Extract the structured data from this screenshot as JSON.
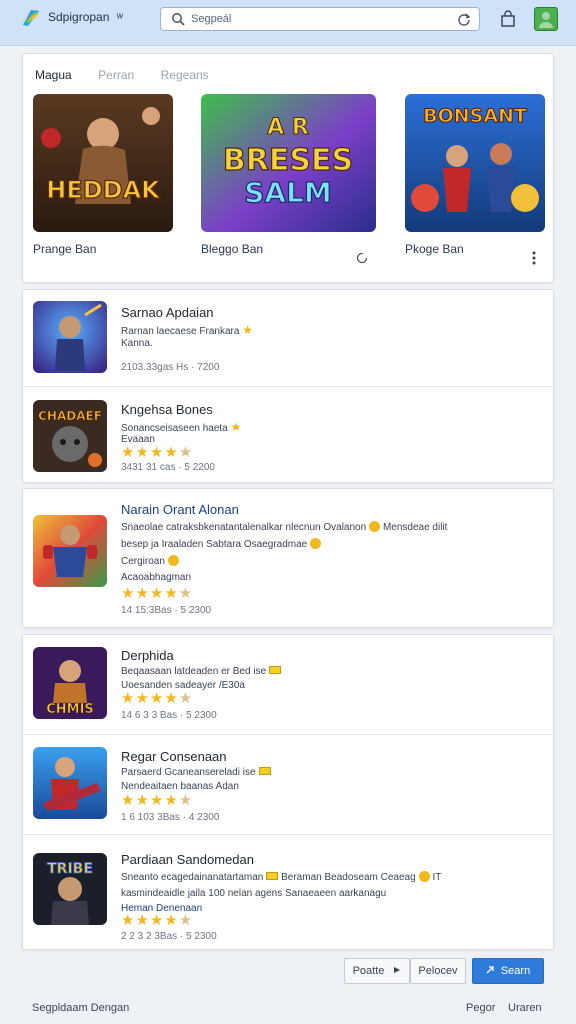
{
  "header": {
    "brand": "Sdpigropan",
    "brand_mark": "ᵂ",
    "search_value": "Segpeál"
  },
  "featured": {
    "tabs": [
      "Magua",
      "Perran",
      "Regeans"
    ],
    "games": [
      {
        "name": "Prange Ban",
        "art_text": "HEDDAK"
      },
      {
        "name": "Bleggo Ban",
        "art_text": "BRESES",
        "art_text2": "SALM",
        "art_text0": "A R"
      },
      {
        "name": "Pkoge Ban",
        "art_text": "BONSANT"
      }
    ]
  },
  "list1": [
    {
      "title": "Sarnao Apdaian",
      "line1": "Rarnan laecaese Frankara",
      "line2": "Kanna.",
      "meta": "2103.33gas Hs · 7200"
    },
    {
      "title": "Kngehsa Bones",
      "line1": "Sonancseisaseen haeta",
      "line2": "Evaaan",
      "meta": "3431 31 cas · 5 2200",
      "stars": "★★★★",
      "thumb_text": "CHADAEF"
    }
  ],
  "list2": [
    {
      "title": "Narain Orant Alonan",
      "line1": "Snaeolae catraksbkenatantalenalkar nlecnun Ovalanon",
      "line1b": "Mensdeae dilit",
      "line2": "besep ja Iraaladen Sabtara Osaegradmae",
      "line3": "Cergiroan",
      "line4": "Acaoabhagman",
      "stars": "★★★★",
      "meta": "14 15:3Bas · 5 2300"
    }
  ],
  "list3": [
    {
      "title": "Derphida",
      "line1": "Beqaasaan latdeaden er Bed ise",
      "line2": "Uoesanden sadeayer /E30a",
      "stars": "★★★★",
      "meta": "14 6 3 3 Bas · 5 2300",
      "thumb_text": "CHMIS"
    },
    {
      "title": "Regar Consenaan",
      "line1": "Parsaerd Gcaneansereladi ise",
      "line2": "Nendeaitaen baanas Adan",
      "stars": "★★★★",
      "meta": "1 6 103 3Bas · 4 2300"
    },
    {
      "title": "Pardiaan Sandomedan",
      "line1": "Sneanto ecagedainanatartaman",
      "line1b": "Beraman Beadoseam Ceaeag",
      "line1c": "IT",
      "line2": "kasmindeaidle jaila 100 nelan agens Sanaeaeen aarkanagu",
      "line3": "Heman Denenaan",
      "stars": "★★★★",
      "meta": "2 2 3 2 3Bas · 5 2300",
      "thumb_text": "TRIBE"
    }
  ],
  "actions": {
    "btn_a": "Poatte",
    "btn_b": "Pelocev",
    "btn_primary": "Searn"
  },
  "footer": {
    "left": "Segpldaam Dengan",
    "right1": "Pegor",
    "right2": "Uraren"
  },
  "colors": {
    "accent": "#2f7bd9",
    "star": "#f4b81e",
    "header_bg": "#cfe2f7"
  }
}
